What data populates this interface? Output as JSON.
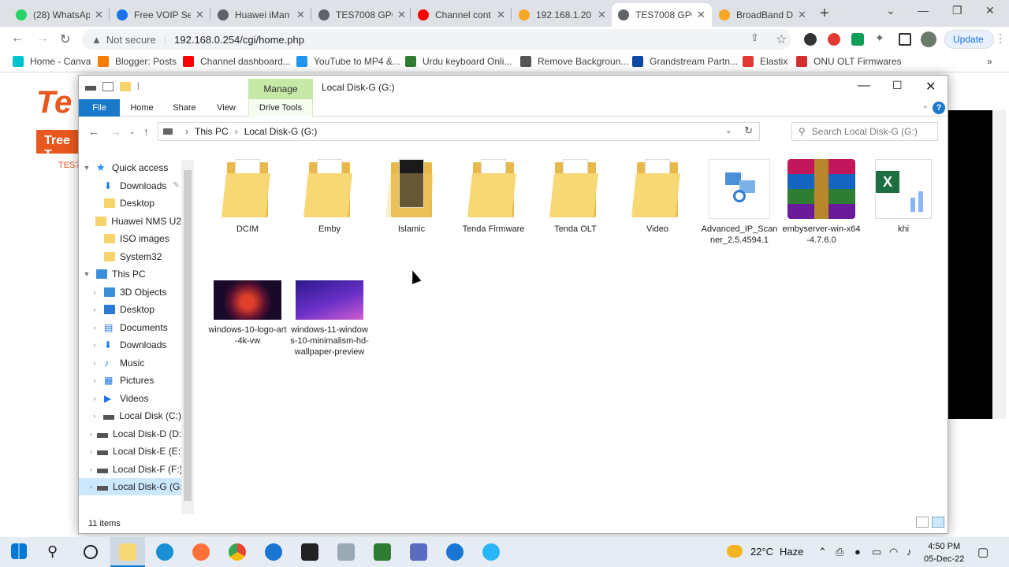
{
  "browser": {
    "tabs": [
      {
        "title": "(28) WhatsApp",
        "color": "#25d366"
      },
      {
        "title": "Free VOIP Se",
        "color": "#1a73e8"
      },
      {
        "title": "Huawei iMan",
        "color": "#5f6368"
      },
      {
        "title": "TES7008 GPC",
        "color": "#5f6368"
      },
      {
        "title": "Channel cont",
        "color": "#ff0000"
      },
      {
        "title": "192.168.1.20",
        "color": "#f5a623"
      },
      {
        "title": "TES7008 GPC",
        "color": "#5f6368"
      },
      {
        "title": "BroadBand D",
        "color": "#f5a623"
      }
    ],
    "address": {
      "warning": "Not secure",
      "url": "192.168.0.254/cgi/home.php"
    },
    "update_label": "Update",
    "bookmarks": [
      {
        "label": "Home - Canva",
        "color": "#00c4cc"
      },
      {
        "label": "Blogger: Posts",
        "color": "#f57d00"
      },
      {
        "label": "Channel dashboard...",
        "color": "#ff0000"
      },
      {
        "label": "YouTube to MP4 &...",
        "color": "#2196f3"
      },
      {
        "label": "Urdu keyboard Onli...",
        "color": "#2e7d32"
      },
      {
        "label": "Remove Backgroun...",
        "color": "#555555"
      },
      {
        "label": "Grandstream Partn...",
        "color": "#0d47a1"
      },
      {
        "label": "Elastix",
        "color": "#e53935"
      },
      {
        "label": "ONU OLT Firmwares",
        "color": "#d32f2f"
      }
    ]
  },
  "bg": {
    "logo": "Te",
    "tree": "Tree T",
    "side": "TES7"
  },
  "explorer": {
    "manage": "Manage",
    "title": "Local Disk-G (G:)",
    "ribbon_tabs": [
      "File",
      "Home",
      "Share",
      "View",
      "Drive Tools"
    ],
    "breadcrumb": [
      "This PC",
      "Local Disk-G (G:)"
    ],
    "search_placeholder": "Search Local Disk-G (G:)",
    "nav": [
      {
        "label": "Quick access",
        "icon": "star",
        "level": 0,
        "exp": "expanded"
      },
      {
        "label": "Downloads",
        "icon": "download",
        "level": 1,
        "pin": true
      },
      {
        "label": "Desktop",
        "icon": "folder",
        "level": 1
      },
      {
        "label": "Huawei NMS U2",
        "icon": "folder",
        "level": 1
      },
      {
        "label": "ISO images",
        "icon": "folder",
        "level": 1
      },
      {
        "label": "System32",
        "icon": "folder",
        "level": 1
      },
      {
        "label": "This PC",
        "icon": "pc",
        "level": 0,
        "exp": "expanded"
      },
      {
        "label": "3D Objects",
        "icon": "cube",
        "level": 1,
        "exp": "collapsed"
      },
      {
        "label": "Desktop",
        "icon": "desktop",
        "level": 1,
        "exp": "collapsed"
      },
      {
        "label": "Documents",
        "icon": "docs",
        "level": 1,
        "exp": "collapsed"
      },
      {
        "label": "Downloads",
        "icon": "download",
        "level": 1,
        "exp": "collapsed"
      },
      {
        "label": "Music",
        "icon": "music",
        "level": 1,
        "exp": "collapsed"
      },
      {
        "label": "Pictures",
        "icon": "pictures",
        "level": 1,
        "exp": "collapsed"
      },
      {
        "label": "Videos",
        "icon": "videos",
        "level": 1,
        "exp": "collapsed"
      },
      {
        "label": "Local Disk (C:)",
        "icon": "drive",
        "level": 1,
        "exp": "collapsed"
      },
      {
        "label": "Local Disk-D (D:)",
        "icon": "drive",
        "level": 1,
        "exp": "collapsed"
      },
      {
        "label": "Local Disk-E (E:)",
        "icon": "drive",
        "level": 1,
        "exp": "collapsed"
      },
      {
        "label": "Local Disk-F (F:)",
        "icon": "drive",
        "level": 1,
        "exp": "collapsed"
      },
      {
        "label": "Local Disk-G (G:)",
        "icon": "drive",
        "level": 1,
        "exp": "collapsed",
        "selected": true
      }
    ],
    "files": [
      {
        "name": "DCIM",
        "kind": "folder"
      },
      {
        "name": "Emby",
        "kind": "folder"
      },
      {
        "name": "Islamic",
        "kind": "folder-dark"
      },
      {
        "name": "Tenda Firmware",
        "kind": "folder"
      },
      {
        "name": "Tenda OLT",
        "kind": "folder"
      },
      {
        "name": "Video",
        "kind": "folder"
      },
      {
        "name": "Advanced_IP_Scanner_2.5.4594.1",
        "kind": "app-scanner"
      },
      {
        "name": "embyserver-win-x64-4.7.6.0",
        "kind": "app-winrar"
      },
      {
        "name": "khi",
        "kind": "excel"
      },
      {
        "name": "windows-10-logo-art-4k-vw",
        "kind": "image-red"
      },
      {
        "name": "windows-11-windows-10-minimalism-hd-wallpaper-preview",
        "kind": "image-purple"
      }
    ],
    "status": "11 items"
  },
  "taskbar": {
    "weather": {
      "temp": "22°C",
      "desc": "Haze"
    },
    "time": "4:50 PM",
    "date": "05-Dec-22"
  }
}
